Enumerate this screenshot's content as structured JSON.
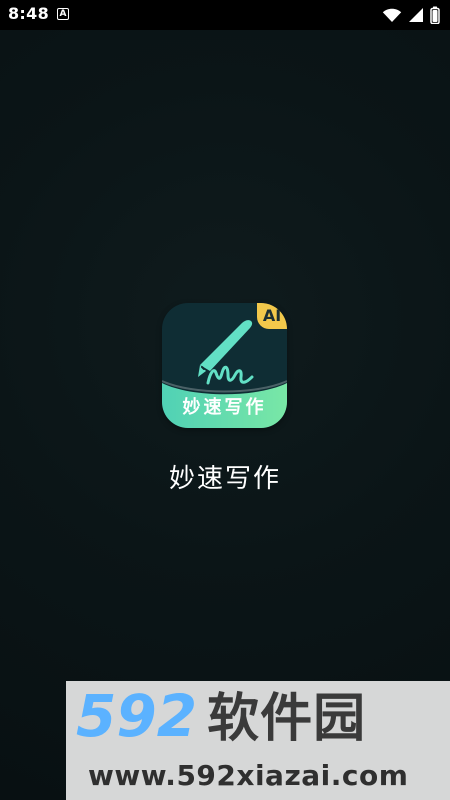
{
  "status_bar": {
    "time": "8:48",
    "a_icon": "A",
    "icons": [
      "a-icon",
      "wifi-icon",
      "cell-signal-icon",
      "battery-icon"
    ]
  },
  "splash": {
    "icon_label": "妙速写作",
    "badge": "AI",
    "title": "妙速写作",
    "icon_name": "pen-writing-icon"
  },
  "watermark": {
    "brand_num": "592",
    "brand_cn": "软件园",
    "url": "www.592xiazai.com"
  },
  "colors": {
    "background": "#0b1517",
    "icon_bg": "#0f2d34",
    "icon_gradient_start": "#50d1b5",
    "icon_gradient_end": "#79e7a6",
    "badge": "#f2c84b",
    "watermark_blue": "#5bb2ff"
  }
}
